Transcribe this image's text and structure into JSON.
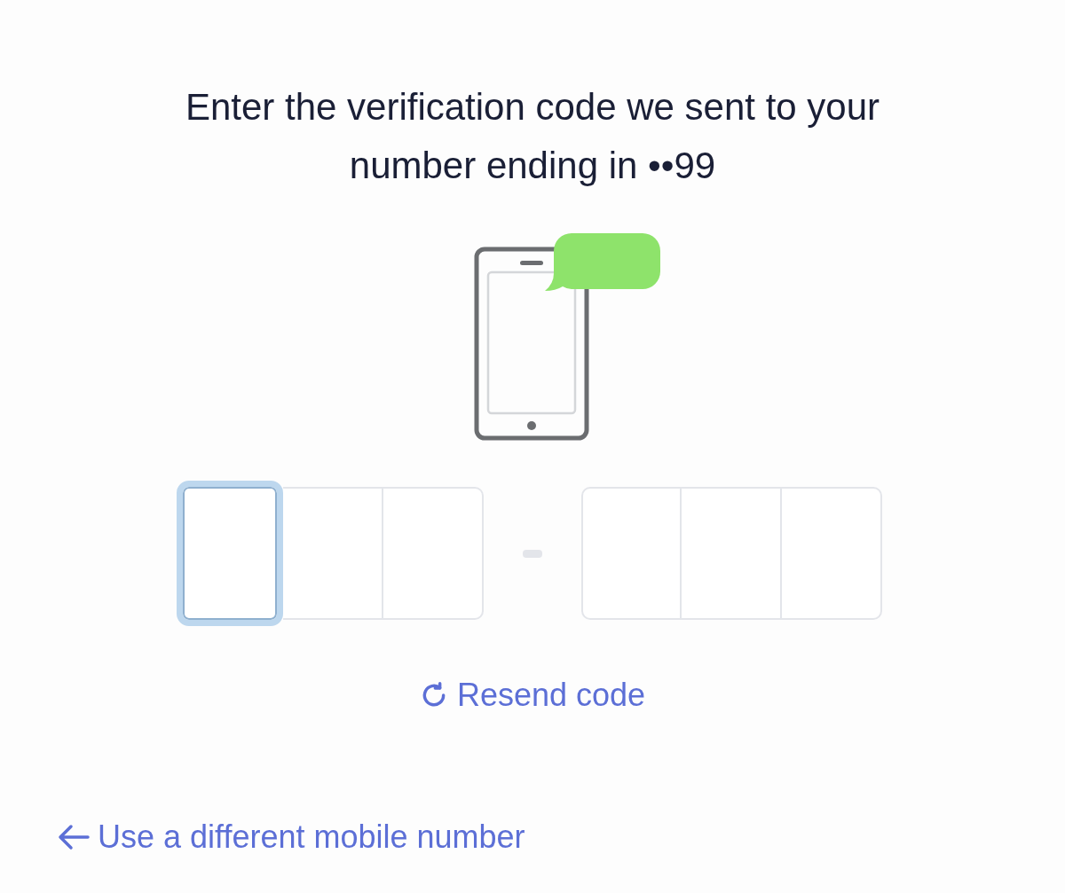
{
  "title": "Enter the verification code we sent to your number ending in ••99",
  "code_groups": [
    {
      "cells": [
        {
          "focused": true
        },
        {
          "focused": false
        },
        {
          "focused": false
        }
      ]
    },
    {
      "cells": [
        {
          "focused": false
        },
        {
          "focused": false
        },
        {
          "focused": false
        }
      ]
    }
  ],
  "resend_link": "Resend code",
  "back_link": "Use a different mobile number"
}
